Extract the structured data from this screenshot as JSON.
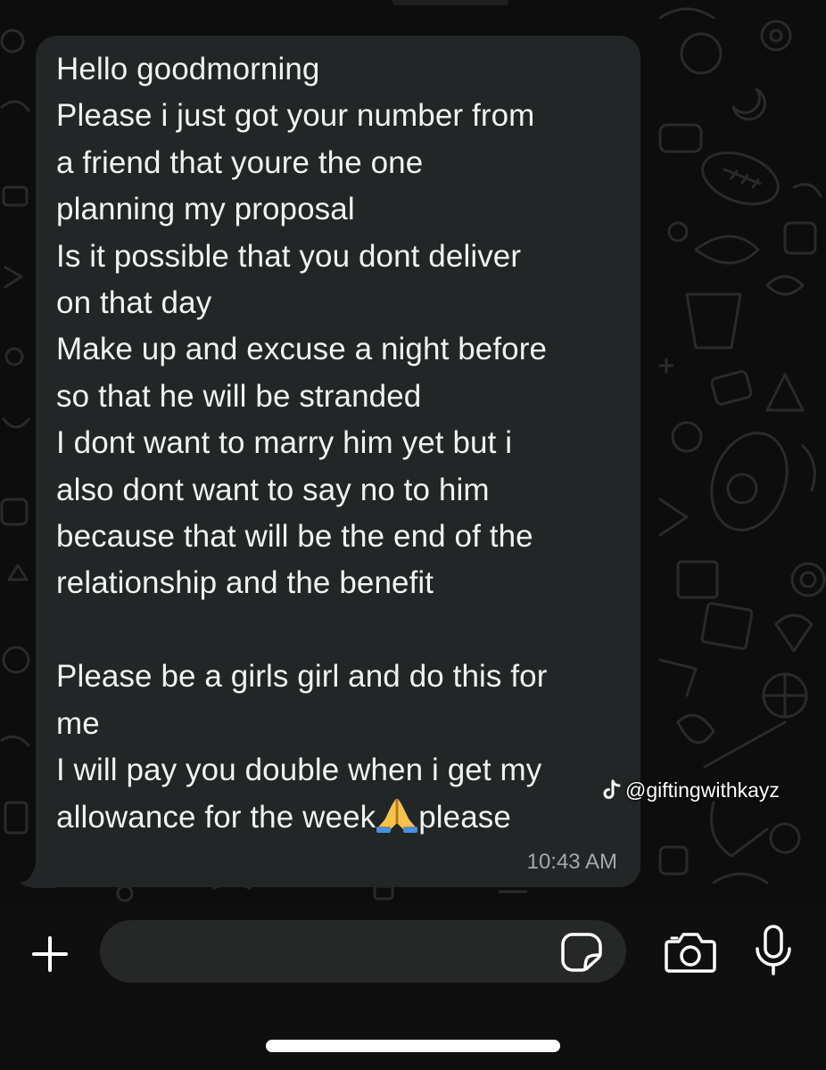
{
  "message": {
    "lines": [
      "Hello goodmorning",
      "Please i just got your number from",
      "a friend that youre the one",
      "planning my proposal",
      "Is it possible that you dont deliver",
      "on that day",
      "Make up and excuse a night before",
      "so that he will be stranded",
      "I dont want to marry him yet but i",
      "also dont want to say no to him",
      "because that will be the end of the",
      "relationship and the benefit",
      "",
      "Please be a girls girl and do this for",
      "me",
      "I will pay you double when i get my",
      "allowance for the week"
    ],
    "last_line_after_emoji": "please",
    "emoji": "🙏",
    "emoji_name": "folded-hands-icon",
    "timestamp": "10:43 AM"
  },
  "watermark": {
    "handle": "@giftingwithkayz",
    "icon": "tiktok-icon"
  },
  "composer": {
    "placeholder": "",
    "value": "",
    "icons": [
      "plus-icon",
      "sticker-icon",
      "camera-icon",
      "microphone-icon"
    ]
  },
  "colors": {
    "background": "#0d0d0d",
    "bubble": "#232626",
    "text": "#f2f2f2",
    "timestamp": "#a4a8aa",
    "input_field": "#262828"
  }
}
